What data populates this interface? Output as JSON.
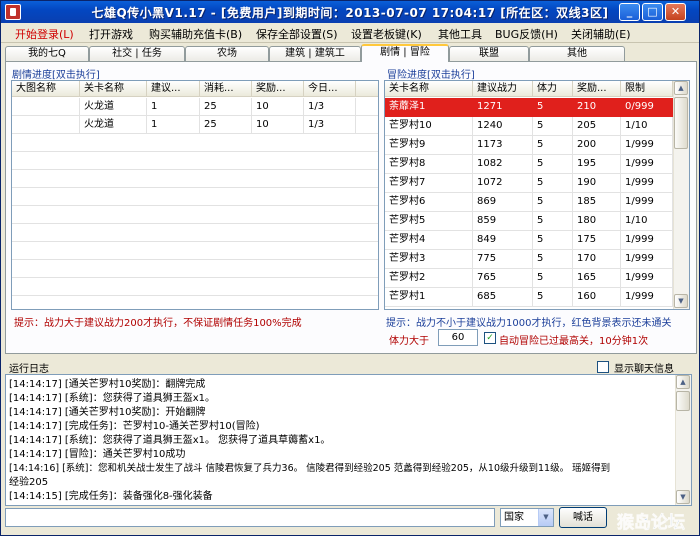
{
  "window": {
    "title": "七雄Q传小黑V1.17 - [免费用户]到期时间：2013-07-07 17:04:17 [所在区：双线3区]",
    "min_label": "_",
    "max_label": "□",
    "close_label": "✕"
  },
  "menu": [
    {
      "label": "开始登录(L)",
      "start": true
    },
    {
      "label": "打开游戏"
    },
    {
      "label": "购买辅助充值卡(B)"
    },
    {
      "label": "保存全部设置(S)"
    },
    {
      "label": "设置老板键(K)"
    },
    {
      "label": "其他工具"
    },
    {
      "label": "BUG反馈(H)"
    },
    {
      "label": "关闭辅助(E)"
    }
  ],
  "tabs": [
    {
      "label": "我的七Q"
    },
    {
      "label": "社交 | 任务"
    },
    {
      "label": "农场"
    },
    {
      "label": "建筑 | 建筑工"
    },
    {
      "label": "剧情 | 冒险",
      "active": true
    },
    {
      "label": "联盟"
    },
    {
      "label": "其他"
    }
  ],
  "story": {
    "title": "剧情进度[双击执行]",
    "headers": [
      "大图名称",
      "关卡名称",
      "建议...",
      "消耗...",
      "奖励...",
      "今日..."
    ],
    "rows": [
      [
        "",
        "火龙道",
        "1",
        "25",
        "10",
        "1/3"
      ],
      [
        "",
        "火龙道",
        "1",
        "25",
        "10",
        "1/3"
      ]
    ],
    "hint": "提示：战力大于建议战力200才执行，不保证剧情任务100%完成"
  },
  "adventure": {
    "title": "冒险进度[双击执行]",
    "headers": [
      "关卡名称",
      "建议战力",
      "体力",
      "奖励...",
      "限制"
    ],
    "rows": [
      {
        "cells": [
          "荼蘼泽1",
          "1271",
          "5",
          "210",
          "0/999"
        ],
        "red": true
      },
      {
        "cells": [
          "芒罗村10",
          "1240",
          "5",
          "205",
          "1/10"
        ]
      },
      {
        "cells": [
          "芒罗村9",
          "1173",
          "5",
          "200",
          "1/999"
        ]
      },
      {
        "cells": [
          "芒罗村8",
          "1082",
          "5",
          "195",
          "1/999"
        ]
      },
      {
        "cells": [
          "芒罗村7",
          "1072",
          "5",
          "190",
          "1/999"
        ]
      },
      {
        "cells": [
          "芒罗村6",
          "869",
          "5",
          "185",
          "1/999"
        ]
      },
      {
        "cells": [
          "芒罗村5",
          "859",
          "5",
          "180",
          "1/10"
        ]
      },
      {
        "cells": [
          "芒罗村4",
          "849",
          "5",
          "175",
          "1/999"
        ]
      },
      {
        "cells": [
          "芒罗村3",
          "775",
          "5",
          "170",
          "1/999"
        ]
      },
      {
        "cells": [
          "芒罗村2",
          "765",
          "5",
          "165",
          "1/999"
        ]
      },
      {
        "cells": [
          "芒罗村1",
          "685",
          "5",
          "160",
          "1/999"
        ]
      }
    ],
    "hint": "提示：战力不小于建议战力1000才执行，红色背景表示还未通关",
    "stamina_label": "体力大于",
    "stamina_value": "60",
    "auto_label": "自动冒险已过最高关，10分钟1次",
    "auto_checked": "✓"
  },
  "log": {
    "label": "运行日志",
    "show_chat_label": "显示聊天信息",
    "lines": [
      "[14:14:17] [通关芒罗村10奖励]：翻牌完成",
      "[14:14:17] [系统]：您获得了道具狮王盔x1。",
      "[14:14:17] [通关芒罗村10奖励]：开始翻牌",
      "[14:14:17] [完成任务]：芒罗村10-通关芒罗村10(冒险)",
      "[14:14:17] [系统]：您获得了道具狮王盔x1。 您获得了道具草薅蓄x1。",
      "[14:14:17] [冒险]：通关芒罗村10成功",
      "[14:14:16] [系统]：您和机关战士发生了战斗 信陵君恢复了兵力36。 信陵君得到经验205 范蠡得到经验205，从10级升级到11级。 瑶姬得到",
      "经验205",
      "[14:14:15] [完成任务]：装备强化8-强化装备"
    ]
  },
  "bottom": {
    "channel": "国家",
    "send_label": "喊话"
  },
  "watermark": "猴岛论坛"
}
